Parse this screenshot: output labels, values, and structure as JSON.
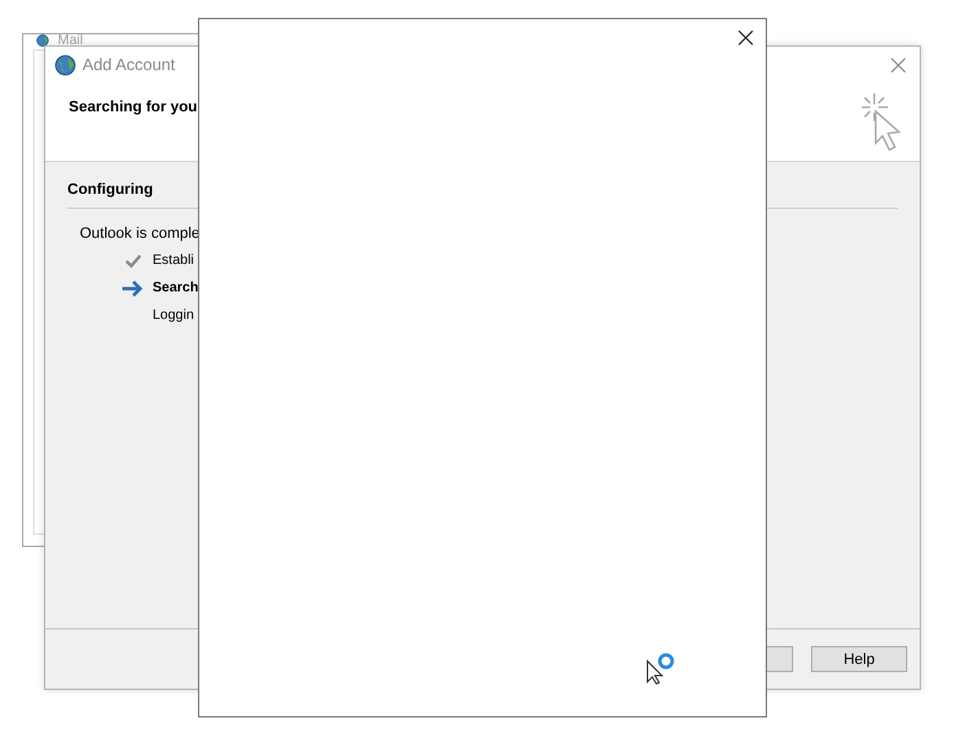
{
  "mail_window": {
    "title": "Mail"
  },
  "add_account": {
    "title": "Add Account",
    "heading": "Searching for you",
    "section": "Configuring",
    "intro": "Outlook is comple",
    "steps": [
      {
        "label": "Establi",
        "kind": "done"
      },
      {
        "label": "Search",
        "kind": "current"
      },
      {
        "label": "Loggin",
        "kind": "pending"
      }
    ],
    "buttons": [
      {
        "kind": "covered"
      },
      {
        "kind": "labeled",
        "label": "Help"
      }
    ]
  },
  "popup": {
    "kind": "blank"
  }
}
